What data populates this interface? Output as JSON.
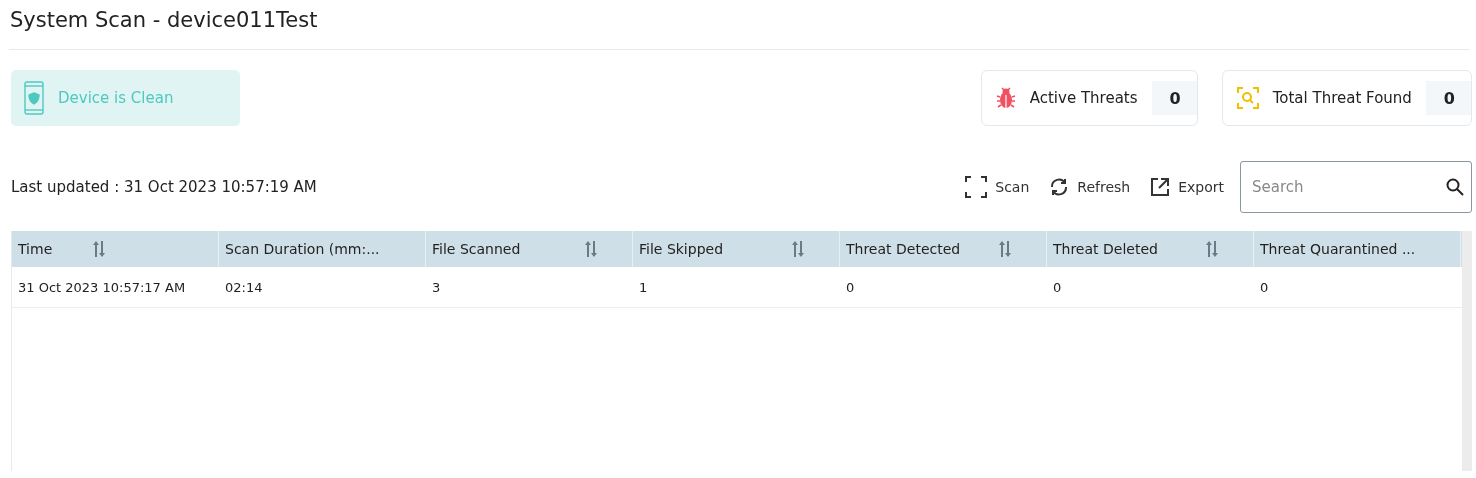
{
  "title": "System Scan - device011Test",
  "status": {
    "label": "Device is Clean"
  },
  "counters": [
    {
      "kind": "bug",
      "label": "Active Threats",
      "value": "0"
    },
    {
      "kind": "search",
      "label": "Total Threat Found",
      "value": "0"
    }
  ],
  "last_updated": "Last updated : 31 Oct 2023 10:57:19 AM",
  "actions": [
    {
      "kind": "scan",
      "label": "Scan"
    },
    {
      "kind": "refresh",
      "label": "Refresh"
    },
    {
      "kind": "export",
      "label": "Export"
    }
  ],
  "search": {
    "placeholder": "Search"
  },
  "table": {
    "columns": [
      {
        "label": "Time",
        "sortable": true
      },
      {
        "label": "Scan Duration (mm:...",
        "sortable": false
      },
      {
        "label": "File Scanned",
        "sortable": true
      },
      {
        "label": "File Skipped",
        "sortable": true
      },
      {
        "label": "Threat Detected",
        "sortable": true
      },
      {
        "label": "Threat Deleted",
        "sortable": true
      },
      {
        "label": "Threat Quarantined ...",
        "sortable": false
      }
    ],
    "rows": [
      [
        "31 Oct 2023 10:57:17 AM",
        "02:14",
        "3",
        "1",
        "0",
        "0",
        "0"
      ]
    ]
  }
}
